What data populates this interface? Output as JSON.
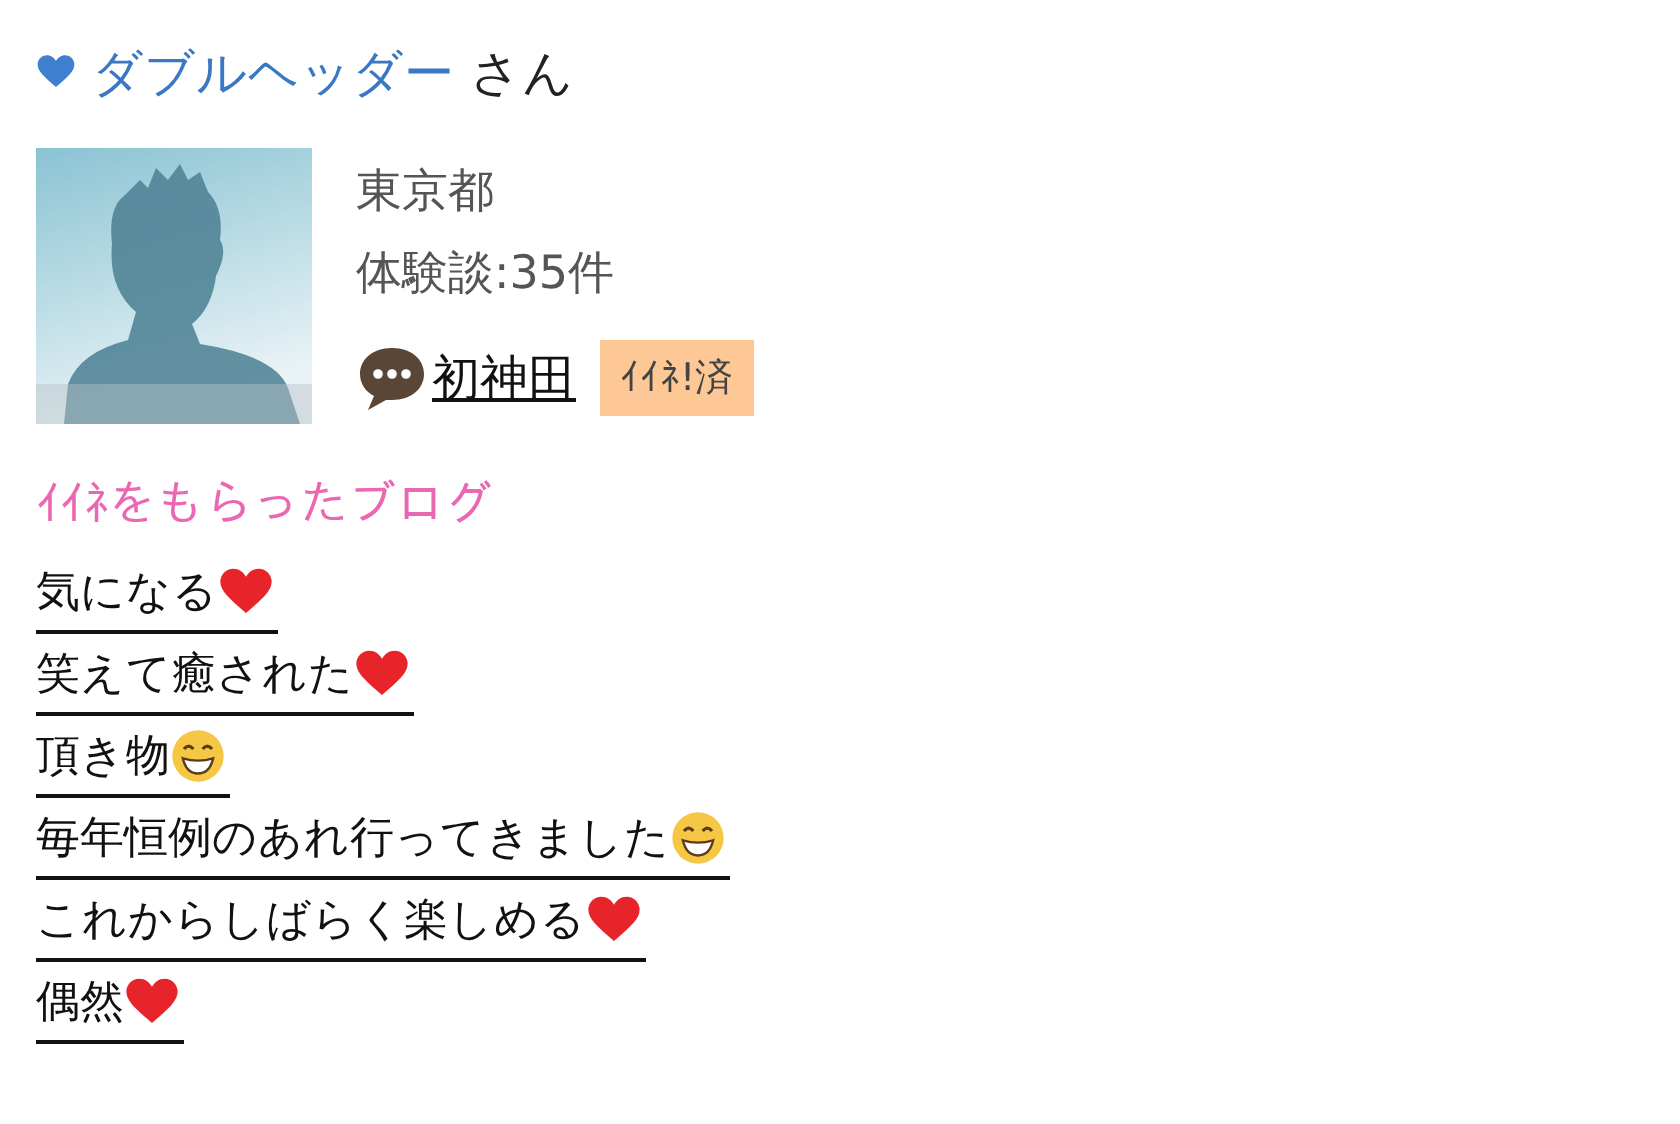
{
  "user": {
    "name": "ダブルヘッダー",
    "suffix": "さん"
  },
  "profile": {
    "location": "東京都",
    "reviews": "体験談:35件",
    "latest": "初神田",
    "badge": "ｲｲﾈ!済"
  },
  "blog_section": {
    "title": "ｲｲﾈをもらったブログ",
    "items": [
      {
        "title": "気になる",
        "kind": "heart"
      },
      {
        "title": "笑えて癒された",
        "kind": "heart"
      },
      {
        "title": "頂き物",
        "kind": "grin"
      },
      {
        "title": "毎年恒例のあれ行ってきました",
        "kind": "grin"
      },
      {
        "title": "これからしばらく楽しめる",
        "kind": "heart"
      },
      {
        "title": "偶然",
        "kind": "heart"
      }
    ]
  }
}
